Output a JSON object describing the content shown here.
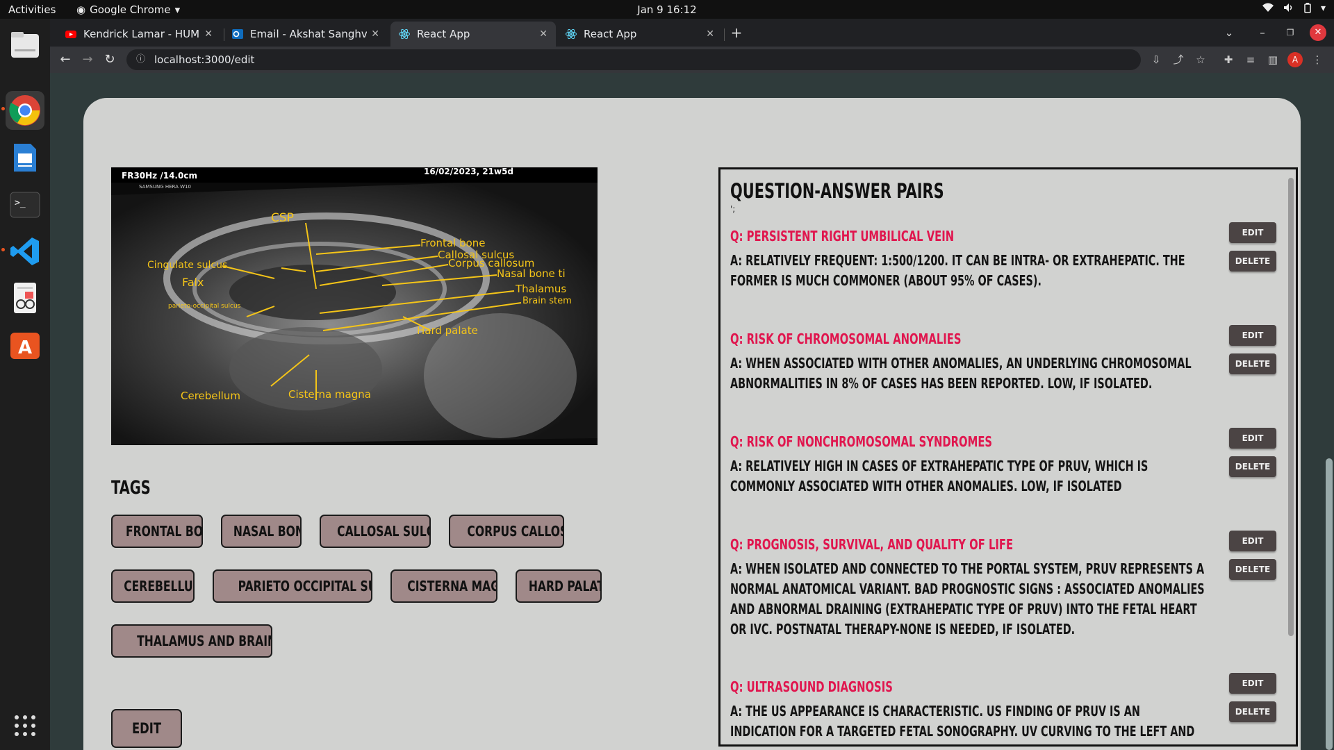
{
  "system": {
    "activities": "Activities",
    "app_name": "Google Chrome",
    "clock": "Jan 9  16:12"
  },
  "browser": {
    "tabs": [
      {
        "label": "Kendrick Lamar - HUMBLE",
        "favicon": "youtube-icon"
      },
      {
        "label": "Email - Akshat Sanghvi - C",
        "favicon": "outlook-icon"
      },
      {
        "label": "React App",
        "favicon": "react-icon",
        "active": true
      },
      {
        "label": "React App",
        "favicon": "react-icon"
      }
    ],
    "url": "localhost:3000/edit",
    "profile_initial": "A"
  },
  "image": {
    "header_left": "FR30Hz /14.0cm",
    "header_right": "16/02/2023, 21w5d",
    "device": "SAMSUNG HERA W10",
    "labels": {
      "csp": "CSP",
      "frontal_bone": "Frontal bone",
      "callosal_sulcus": "Callosal sulcus",
      "corpus_callosum": "Corpus callosum",
      "nasal_bone": "Nasal bone ti",
      "cingulate_sulcus": "Cingulate sulcus",
      "falx": "Falx",
      "thalamus": "Thalamus",
      "brain_stem": "Brain stem",
      "parieto_occipital": "parieto-occipital sulcus",
      "hard_palate": "Hard palate",
      "cerebellum": "Cerebellum",
      "cisterna_magna": "Cisterna magna"
    }
  },
  "tags": {
    "heading": "TAGS",
    "items": [
      "FRONTAL BONE",
      "NASAL BONE",
      "CALLOSAL SULCUS",
      "CORPUS CALLOSUM",
      "CEREBELLUM",
      "PARIETO OCCIPITAL SULCUS",
      "CISTERNA MAGNA",
      "HARD PALATE",
      "THALAMUS AND BRAINSTEM"
    ],
    "edit_button": "EDIT TAGS"
  },
  "qa": {
    "title": "QUESTION-ANSWER PAIRS",
    "subtitle": "';",
    "edit_label": "EDIT",
    "delete_label": "DELETE",
    "pairs": [
      {
        "q": "Q: PERSISTENT RIGHT UMBILICAL VEIN",
        "a": "A: RELATIVELY FREQUENT: 1:500/1200. IT CAN BE INTRA- OR EXTRAHEPATIC. THE FORMER IS MUCH COMMONER (ABOUT 95% OF CASES)."
      },
      {
        "q": "Q: RISK OF CHROMOSOMAL ANOMALIES",
        "a": "A: WHEN ASSOCIATED WITH OTHER ANOMALIES, AN UNDERLYING CHROMOSOMAL ABNORMALITIES IN 8% OF CASES HAS BEEN REPORTED. LOW, IF ISOLATED."
      },
      {
        "q": "Q: RISK OF NONCHROMOSOMAL SYNDROMES",
        "a": "A: RELATIVELY HIGH IN CASES OF EXTRAHEPATIC TYPE OF PRUV, WHICH IS COMMONLY ASSOCIATED WITH OTHER ANOMALIES. LOW, IF ISOLATED"
      },
      {
        "q": "Q: PROGNOSIS, SURVIVAL, AND QUALITY OF LIFE",
        "a": "A: WHEN ISOLATED AND CONNECTED TO THE PORTAL SYSTEM, PRUV REPRESENTS A NORMAL ANATOMICAL VARIANT. BAD PROGNOSTIC SIGNS : ASSOCIATED ANOMALIES AND ABNORMAL DRAINING (EXTRAHEPATIC TYPE OF PRUV) INTO THE FETAL HEART OR IVC. POSTNATAL THERAPY-NONE IS NEEDED, IF ISOLATED."
      },
      {
        "q": "Q: ULTRASOUND DIAGNOSIS",
        "a": "A: THE US APPEARANCE IS CHARACTERISTIC. US FINDING OF PRUV IS AN INDICATION FOR A TARGETED FETAL SONOGRAPHY. UV CURVING TO THE LEFT AND TOWARD THE STOMACH, USUALLY CONNECTING TO THE RIGHT PORTAL VEIN RATHER THAN TO THE LEFT PORTAL VEIN"
      }
    ]
  },
  "colors": {
    "question": "#e0164e",
    "tag_bg": "#a08989",
    "button_bg": "#4b4444",
    "card_bg": "#d1d2d0",
    "page_bg": "#2f3b3b",
    "annotation": "#f5c518"
  }
}
